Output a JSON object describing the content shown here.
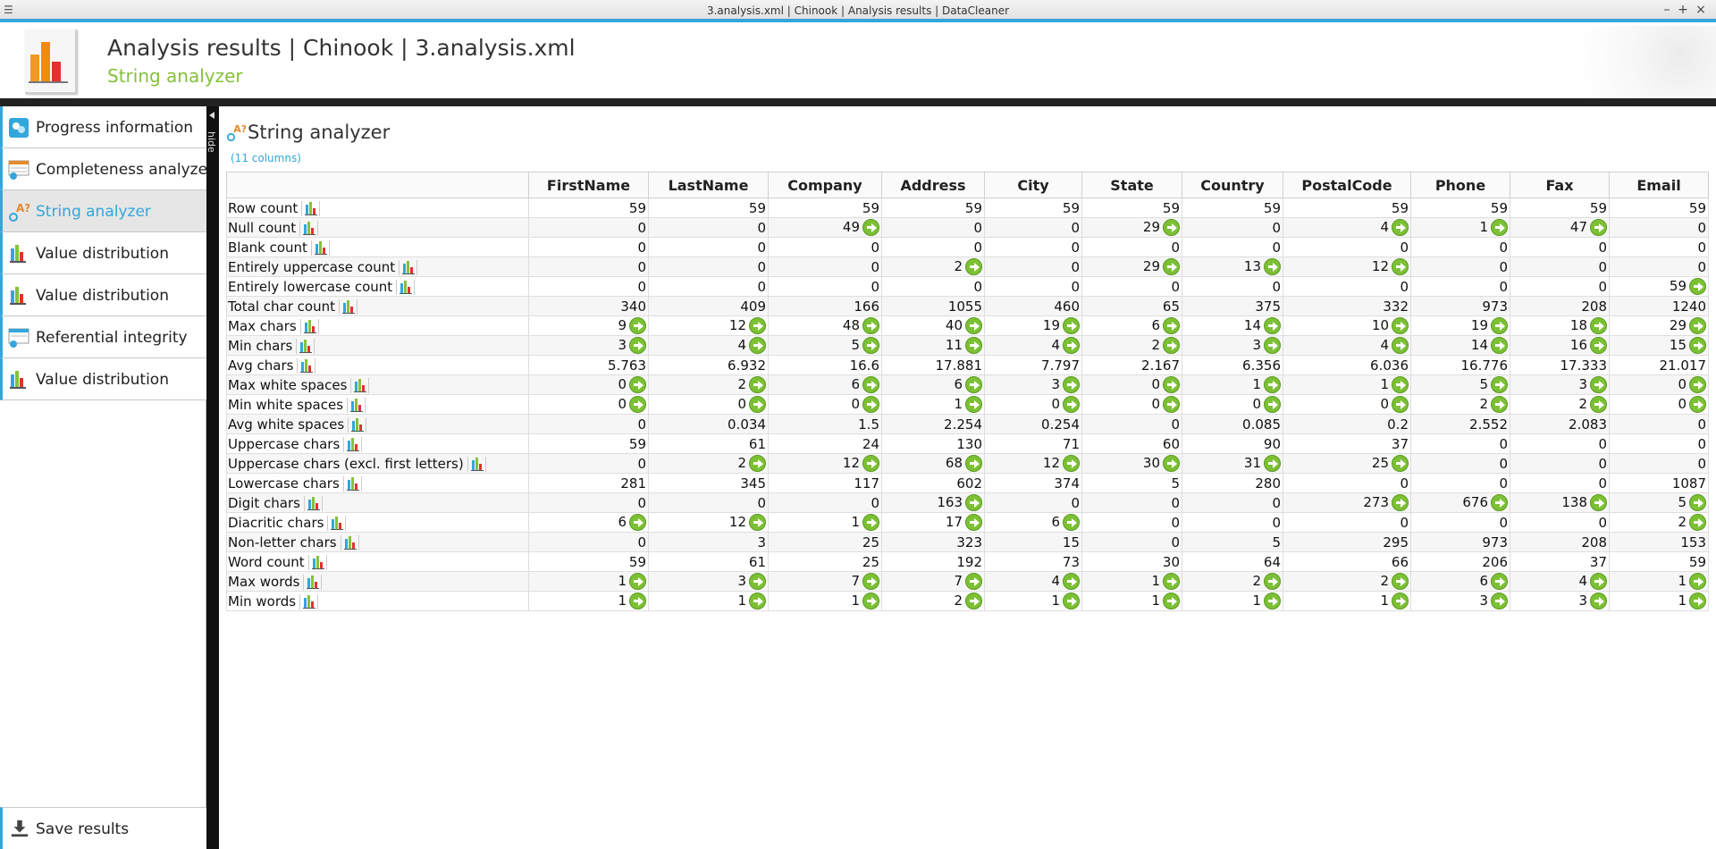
{
  "window": {
    "title": "3.analysis.xml | Chinook | Analysis results | DataCleaner",
    "minimize": "–",
    "maximize": "+",
    "close": "×"
  },
  "header": {
    "title": "Analysis results | Chinook | 3.analysis.xml",
    "subtitle": "String analyzer"
  },
  "sidebar": {
    "items": [
      {
        "label": "Progress information",
        "icon": "progress-icon"
      },
      {
        "label": "Completeness analyzer",
        "icon": "completeness-icon"
      },
      {
        "label": "String analyzer",
        "icon": "string-analyzer-icon",
        "active": true
      },
      {
        "label": "Value distribution",
        "icon": "bar-chart-icon"
      },
      {
        "label": "Value distribution",
        "icon": "bar-chart-icon"
      },
      {
        "label": "Referential integrity",
        "icon": "referential-integrity-icon"
      },
      {
        "label": "Value distribution",
        "icon": "bar-chart-icon"
      }
    ],
    "save_label": "Save results",
    "hide_label": "hide"
  },
  "main": {
    "title": "String analyzer",
    "subtitle": "(11 columns)"
  },
  "table": {
    "columns": [
      "FirstName",
      "LastName",
      "Company",
      "Address",
      "City",
      "State",
      "Country",
      "PostalCode",
      "Phone",
      "Fax",
      "Email"
    ],
    "rows": [
      {
        "label": "Row count",
        "values": [
          "59",
          "59",
          "59",
          "59",
          "59",
          "59",
          "59",
          "59",
          "59",
          "59",
          "59"
        ],
        "links": [
          0,
          0,
          0,
          0,
          0,
          0,
          0,
          0,
          0,
          0,
          0
        ]
      },
      {
        "label": "Null count",
        "values": [
          "0",
          "0",
          "49",
          "0",
          "0",
          "29",
          "0",
          "4",
          "1",
          "47",
          "0"
        ],
        "links": [
          0,
          0,
          1,
          0,
          0,
          1,
          0,
          1,
          1,
          1,
          0
        ]
      },
      {
        "label": "Blank count",
        "values": [
          "0",
          "0",
          "0",
          "0",
          "0",
          "0",
          "0",
          "0",
          "0",
          "0",
          "0"
        ],
        "links": [
          0,
          0,
          0,
          0,
          0,
          0,
          0,
          0,
          0,
          0,
          0
        ]
      },
      {
        "label": "Entirely uppercase count",
        "values": [
          "0",
          "0",
          "0",
          "2",
          "0",
          "29",
          "13",
          "12",
          "0",
          "0",
          "0"
        ],
        "links": [
          0,
          0,
          0,
          1,
          0,
          1,
          1,
          1,
          0,
          0,
          0
        ]
      },
      {
        "label": "Entirely lowercase count",
        "values": [
          "0",
          "0",
          "0",
          "0",
          "0",
          "0",
          "0",
          "0",
          "0",
          "0",
          "59"
        ],
        "links": [
          0,
          0,
          0,
          0,
          0,
          0,
          0,
          0,
          0,
          0,
          1
        ]
      },
      {
        "label": "Total char count",
        "values": [
          "340",
          "409",
          "166",
          "1055",
          "460",
          "65",
          "375",
          "332",
          "973",
          "208",
          "1240"
        ],
        "links": [
          0,
          0,
          0,
          0,
          0,
          0,
          0,
          0,
          0,
          0,
          0
        ]
      },
      {
        "label": "Max chars",
        "values": [
          "9",
          "12",
          "48",
          "40",
          "19",
          "6",
          "14",
          "10",
          "19",
          "18",
          "29"
        ],
        "links": [
          1,
          1,
          1,
          1,
          1,
          1,
          1,
          1,
          1,
          1,
          1
        ]
      },
      {
        "label": "Min chars",
        "values": [
          "3",
          "4",
          "5",
          "11",
          "4",
          "2",
          "3",
          "4",
          "14",
          "16",
          "15"
        ],
        "links": [
          1,
          1,
          1,
          1,
          1,
          1,
          1,
          1,
          1,
          1,
          1
        ]
      },
      {
        "label": "Avg chars",
        "values": [
          "5.763",
          "6.932",
          "16.6",
          "17.881",
          "7.797",
          "2.167",
          "6.356",
          "6.036",
          "16.776",
          "17.333",
          "21.017"
        ],
        "links": [
          0,
          0,
          0,
          0,
          0,
          0,
          0,
          0,
          0,
          0,
          0
        ]
      },
      {
        "label": "Max white spaces",
        "values": [
          "0",
          "2",
          "6",
          "6",
          "3",
          "0",
          "1",
          "1",
          "5",
          "3",
          "0"
        ],
        "links": [
          1,
          1,
          1,
          1,
          1,
          1,
          1,
          1,
          1,
          1,
          1
        ]
      },
      {
        "label": "Min white spaces",
        "values": [
          "0",
          "0",
          "0",
          "1",
          "0",
          "0",
          "0",
          "0",
          "2",
          "2",
          "0"
        ],
        "links": [
          1,
          1,
          1,
          1,
          1,
          1,
          1,
          1,
          1,
          1,
          1
        ]
      },
      {
        "label": "Avg white spaces",
        "values": [
          "0",
          "0.034",
          "1.5",
          "2.254",
          "0.254",
          "0",
          "0.085",
          "0.2",
          "2.552",
          "2.083",
          "0"
        ],
        "links": [
          0,
          0,
          0,
          0,
          0,
          0,
          0,
          0,
          0,
          0,
          0
        ]
      },
      {
        "label": "Uppercase chars",
        "values": [
          "59",
          "61",
          "24",
          "130",
          "71",
          "60",
          "90",
          "37",
          "0",
          "0",
          "0"
        ],
        "links": [
          0,
          0,
          0,
          0,
          0,
          0,
          0,
          0,
          0,
          0,
          0
        ]
      },
      {
        "label": "Uppercase chars (excl. first letters)",
        "values": [
          "0",
          "2",
          "12",
          "68",
          "12",
          "30",
          "31",
          "25",
          "0",
          "0",
          "0"
        ],
        "links": [
          0,
          1,
          1,
          1,
          1,
          1,
          1,
          1,
          0,
          0,
          0
        ]
      },
      {
        "label": "Lowercase chars",
        "values": [
          "281",
          "345",
          "117",
          "602",
          "374",
          "5",
          "280",
          "0",
          "0",
          "0",
          "1087"
        ],
        "links": [
          0,
          0,
          0,
          0,
          0,
          0,
          0,
          0,
          0,
          0,
          0
        ]
      },
      {
        "label": "Digit chars",
        "values": [
          "0",
          "0",
          "0",
          "163",
          "0",
          "0",
          "0",
          "273",
          "676",
          "138",
          "5"
        ],
        "links": [
          0,
          0,
          0,
          1,
          0,
          0,
          0,
          1,
          1,
          1,
          1
        ]
      },
      {
        "label": "Diacritic chars",
        "values": [
          "6",
          "12",
          "1",
          "17",
          "6",
          "0",
          "0",
          "0",
          "0",
          "0",
          "2"
        ],
        "links": [
          1,
          1,
          1,
          1,
          1,
          0,
          0,
          0,
          0,
          0,
          1
        ]
      },
      {
        "label": "Non-letter chars",
        "values": [
          "0",
          "3",
          "25",
          "323",
          "15",
          "0",
          "5",
          "295",
          "973",
          "208",
          "153"
        ],
        "links": [
          0,
          0,
          0,
          0,
          0,
          0,
          0,
          0,
          0,
          0,
          0
        ]
      },
      {
        "label": "Word count",
        "values": [
          "59",
          "61",
          "25",
          "192",
          "73",
          "30",
          "64",
          "66",
          "206",
          "37",
          "59"
        ],
        "links": [
          0,
          0,
          0,
          0,
          0,
          0,
          0,
          0,
          0,
          0,
          0
        ]
      },
      {
        "label": "Max words",
        "values": [
          "1",
          "3",
          "7",
          "7",
          "4",
          "1",
          "2",
          "2",
          "6",
          "4",
          "1"
        ],
        "links": [
          1,
          1,
          1,
          1,
          1,
          1,
          1,
          1,
          1,
          1,
          1
        ]
      },
      {
        "label": "Min words",
        "values": [
          "1",
          "1",
          "1",
          "2",
          "1",
          "1",
          "1",
          "1",
          "3",
          "3",
          "1"
        ],
        "links": [
          1,
          1,
          1,
          1,
          1,
          1,
          1,
          1,
          1,
          1,
          1
        ]
      }
    ]
  },
  "colors": {
    "accent": "#33a6dc",
    "green": "#85c13a",
    "dark_bar": "#222222"
  }
}
